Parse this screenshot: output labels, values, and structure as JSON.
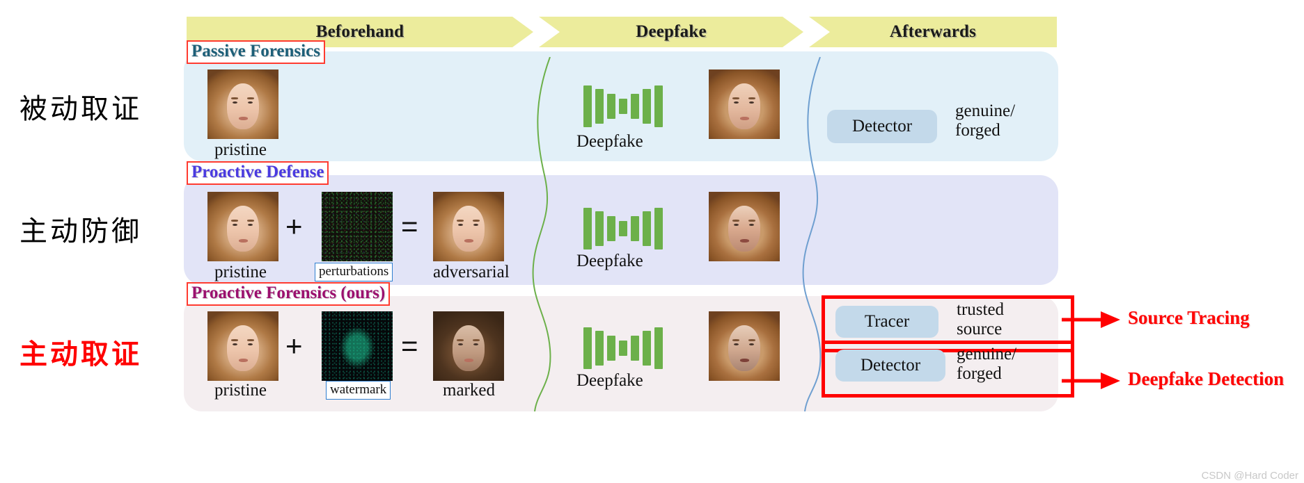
{
  "banner": {
    "stages": [
      {
        "label": "Beforehand"
      },
      {
        "label": "Deepfake"
      },
      {
        "label": "Afterwards"
      }
    ]
  },
  "colors": {
    "banner_fill": "#ecec9c",
    "row1_fill": "#e2f0f8",
    "row2_fill": "#e2e4f7",
    "row3_fill": "#f4eef0",
    "tag_border": "#ff3b30",
    "tag1_text": "#1d5f78",
    "tag2_text": "#4a3ae0",
    "tag3_text": "#9b0f6e",
    "accent_red": "#ff0000",
    "pill_fill": "#c3d9ea",
    "deepfake_green": "#6cb04a",
    "wave_green": "#6cb04a",
    "wave_blue": "#6f9fd0"
  },
  "rows": [
    {
      "tag": "Passive Forensics",
      "side_label": "被动取证",
      "beforehand": {
        "images": [
          {
            "name": "pristine-face",
            "caption": "pristine"
          }
        ],
        "operators": []
      },
      "deepfake": {
        "icon": "deepfake-bars-icon",
        "caption": "Deepfake",
        "output_image": "forged-face"
      },
      "afterwards": {
        "modules": [
          {
            "pill": "Detector",
            "output": [
              "genuine/",
              "forged"
            ]
          }
        ]
      }
    },
    {
      "tag": "Proactive Defense",
      "side_label": "主动防御",
      "beforehand": {
        "images": [
          {
            "name": "pristine-face",
            "caption": "pristine"
          },
          {
            "name": "perturbation-noise",
            "caption": "perturbations",
            "caption_boxed": true
          },
          {
            "name": "adversarial-face",
            "caption": "adversarial"
          }
        ],
        "operators": [
          "+",
          "="
        ]
      },
      "deepfake": {
        "icon": "deepfake-bars-icon",
        "caption": "Deepfake",
        "output_image": "disrupted-face"
      },
      "afterwards": {
        "modules": []
      }
    },
    {
      "tag": "Proactive Forensics (ours)",
      "side_label": "主动取证",
      "beforehand": {
        "images": [
          {
            "name": "pristine-face",
            "caption": "pristine"
          },
          {
            "name": "watermark-noise",
            "caption": "watermark",
            "caption_boxed": true
          },
          {
            "name": "marked-face",
            "caption": "marked"
          }
        ],
        "operators": [
          "+",
          "="
        ]
      },
      "deepfake": {
        "icon": "deepfake-bars-icon",
        "caption": "Deepfake",
        "output_image": "forged-marked-face"
      },
      "afterwards": {
        "modules": [
          {
            "pill": "Tracer",
            "output": [
              "trusted",
              "source"
            ],
            "callout": "Source Tracing"
          },
          {
            "pill": "Detector",
            "output": [
              "genuine/",
              "forged"
            ],
            "callout": "Deepfake Detection"
          }
        ]
      }
    }
  ],
  "callouts": [
    {
      "label": "Source Tracing"
    },
    {
      "label": "Deepfake Detection"
    }
  ],
  "credit": "CSDN @Hard Coder"
}
